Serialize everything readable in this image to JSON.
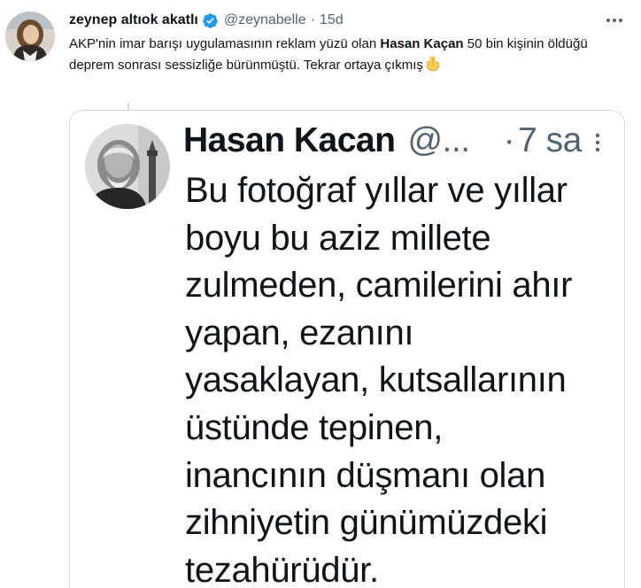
{
  "tweet": {
    "display_name": "zeynep altıok akatlı",
    "handle": "@zeynabelle",
    "separator": "·",
    "time": "15d",
    "text_before": "AKP'nin imar barışı uygulamasının reklam yüzü olan ",
    "text_bold": "Hasan Kaçan",
    "text_after": " 50 bin kişinin öldüğü deprem sonrası sessizliğe bürünmüştü. Tekrar ortaya çıkmış",
    "verified_badge_color": "#1d9bf0",
    "icons": {
      "verified": "verified-badge-icon",
      "more": "more-options-icon",
      "emoji": "pointing-down-emoji"
    }
  },
  "quoted": {
    "display_name": "Hasan Kacan",
    "handle": "@...",
    "separator": "·",
    "time": "7 sa",
    "lines": [
      "Bu fotoğraf yıllar ve yıllar",
      "boyu bu aziz millete",
      "zulmeden, camilerini ahır",
      "yapan, ezanını",
      "yasaklayan, kutsallarının",
      "üstünde tepinen,",
      "inancının düşmanı olan",
      "zihniyetin günümüzdeki",
      "tezahürüdür."
    ]
  },
  "colors": {
    "text": "#0f1419",
    "secondary": "#536471",
    "border": "#cfd9de",
    "accent": "#1d9bf0"
  }
}
